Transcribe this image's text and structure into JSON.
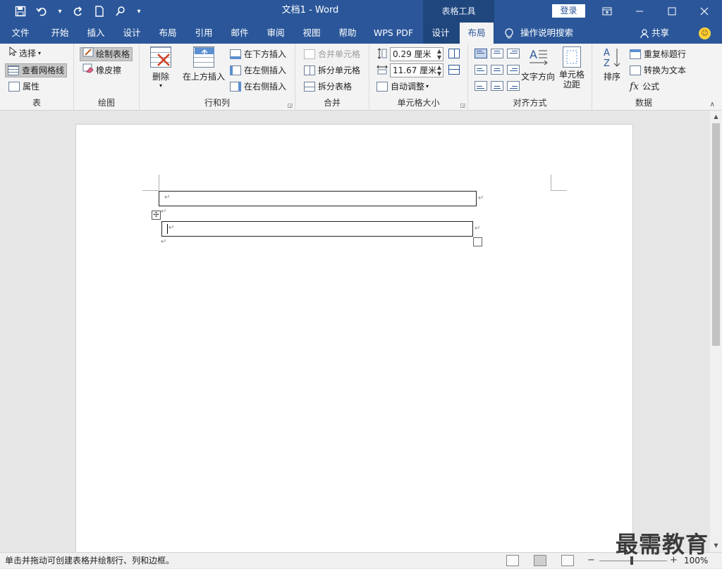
{
  "title_bar": {
    "doc_title": "文档1  -  Word",
    "tool_context": "表格工具",
    "login": "登录",
    "qat_icons": [
      "save-icon",
      "undo-icon",
      "redo-icon",
      "new-doc-icon",
      "touch-mode-icon",
      "customize-icon"
    ],
    "window_controls": [
      "restore-ribbon-icon",
      "minimize-icon",
      "maximize-icon",
      "close-icon"
    ]
  },
  "tabs": [
    "文件",
    "开始",
    "插入",
    "设计",
    "布局",
    "引用",
    "邮件",
    "审阅",
    "视图",
    "帮助",
    "WPS PDF",
    "设计",
    "布局"
  ],
  "active_tab_index": 12,
  "tell_me": "操作说明搜索",
  "share": "共享",
  "ribbon": {
    "table": {
      "label": "表",
      "select": "选择",
      "gridlines": "查看网格线",
      "properties": "属性"
    },
    "draw": {
      "label": "绘图",
      "draw_table": "绘制表格",
      "eraser": "橡皮擦"
    },
    "rows_cols": {
      "label": "行和列",
      "delete": "删除",
      "insert_above": "在上方插入",
      "insert_below": "在下方插入",
      "insert_left": "在左侧插入",
      "insert_right": "在右侧插入"
    },
    "merge": {
      "label": "合并",
      "merge_cells": "合并单元格",
      "split_cells": "拆分单元格",
      "split_table": "拆分表格"
    },
    "cell_size": {
      "label": "单元格大小",
      "height": "0.29 厘米",
      "width": "11.67 厘米",
      "autofit": "自动调整"
    },
    "alignment": {
      "label": "对齐方式",
      "text_direction": "文字方向",
      "cell_margins_1": "单元格",
      "cell_margins_2": "边距"
    },
    "data": {
      "label": "数据",
      "sort": "排序",
      "repeat_header": "重复标题行",
      "convert_text": "转换为文本",
      "formula": "公式"
    }
  },
  "document": {
    "paragraph_mark": "↵"
  },
  "status": {
    "text": "单击并拖动可创建表格并绘制行、列和边框。",
    "zoom": "100%",
    "zoom_minus": "−",
    "zoom_plus": "+"
  },
  "watermark": "最需教育",
  "colors": {
    "accent": "#2b579a",
    "tool_tab": "#20467e",
    "ribbon_bg": "#f3f3f3"
  }
}
